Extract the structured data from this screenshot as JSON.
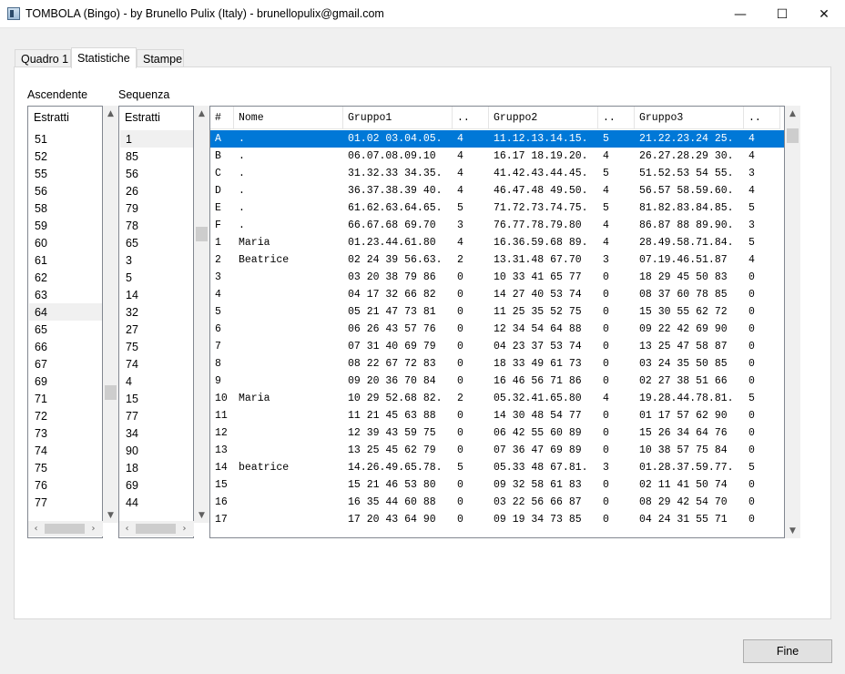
{
  "window": {
    "title": "TOMBOLA (Bingo) - by Brunello Pulix (Italy) - brunellopulix@gmail.com",
    "minimize_glyph": "—",
    "maximize_glyph": "☐",
    "close_glyph": "✕"
  },
  "tabs": [
    "Quadro 1",
    "Statistiche",
    "Stampe"
  ],
  "ascendente": {
    "label": "Ascendente",
    "header": "Estratti",
    "items": [
      "51",
      "52",
      "55",
      "56",
      "58",
      "59",
      "60",
      "61",
      "62",
      "63",
      "64",
      "65",
      "66",
      "67",
      "69",
      "71",
      "72",
      "73",
      "74",
      "75",
      "76",
      "77"
    ],
    "selected": "64"
  },
  "sequenza": {
    "label": "Sequenza",
    "header": "Estratti",
    "items": [
      "1",
      "85",
      "56",
      "26",
      "79",
      "78",
      "65",
      "3",
      "5",
      "14",
      "32",
      "27",
      "75",
      "74",
      "4",
      "15",
      "77",
      "34",
      "90",
      "18",
      "69",
      "44"
    ],
    "selected": "1"
  },
  "grid": {
    "columns": [
      "#",
      "Nome",
      "Gruppo1",
      "..",
      "Gruppo2",
      "..",
      "Gruppo3",
      ".."
    ],
    "rows": [
      [
        "A",
        ".",
        "01.02 03.04.05.",
        "4",
        "11.12.13.14.15.",
        "5",
        "21.22.23.24 25.",
        "4"
      ],
      [
        "B",
        ".",
        "06.07.08.09.10",
        "4",
        "16.17 18.19.20.",
        "4",
        "26.27.28.29 30.",
        "4"
      ],
      [
        "C",
        ".",
        "31.32.33 34.35.",
        "4",
        "41.42.43.44.45.",
        "5",
        "51.52.53 54 55.",
        "3"
      ],
      [
        "D",
        ".",
        "36.37.38.39 40.",
        "4",
        "46.47.48 49.50.",
        "4",
        "56.57 58.59.60.",
        "4"
      ],
      [
        "E",
        ".",
        "61.62.63.64.65.",
        "5",
        "71.72.73.74.75.",
        "5",
        "81.82.83.84.85.",
        "5"
      ],
      [
        "F",
        ".",
        "66.67.68 69.70",
        "3",
        "76.77.78.79.80",
        "4",
        "86.87 88 89.90.",
        "3"
      ],
      [
        "1",
        "Maria",
        "01.23.44.61.80",
        "4",
        "16.36.59.68 89.",
        "4",
        "28.49.58.71.84.",
        "5"
      ],
      [
        "2",
        "Beatrice",
        "02 24 39 56.63.",
        "2",
        "13.31.48 67.70",
        "3",
        "07.19.46.51.87",
        "4"
      ],
      [
        "3",
        "",
        "03 20 38 79 86",
        "0",
        "10 33 41 65 77",
        "0",
        "18 29 45 50 83",
        "0"
      ],
      [
        "4",
        "",
        "04 17 32 66 82",
        "0",
        "14 27 40 53 74",
        "0",
        "08 37 60 78 85",
        "0"
      ],
      [
        "5",
        "",
        "05 21 47 73 81",
        "0",
        "11 25 35 52 75",
        "0",
        "15 30 55 62 72",
        "0"
      ],
      [
        "6",
        "",
        "06 26 43 57 76",
        "0",
        "12 34 54 64 88",
        "0",
        "09 22 42 69 90",
        "0"
      ],
      [
        "7",
        "",
        "07 31 40 69 79",
        "0",
        "04 23 37 53 74",
        "0",
        "13 25 47 58 87",
        "0"
      ],
      [
        "8",
        "",
        "08 22 67 72 83",
        "0",
        "18 33 49 61 73",
        "0",
        "03 24 35 50 85",
        "0"
      ],
      [
        "9",
        "",
        "09 20 36 70 84",
        "0",
        "16 46 56 71 86",
        "0",
        "02 27 38 51 66",
        "0"
      ],
      [
        "10",
        "Maria",
        "10 29 52.68 82.",
        "2",
        "05.32.41.65.80",
        "4",
        "19.28.44.78.81.",
        "5"
      ],
      [
        "11",
        "",
        "11 21 45 63 88",
        "0",
        "14 30 48 54 77",
        "0",
        "01 17 57 62 90",
        "0"
      ],
      [
        "12",
        "",
        "12 39 43 59 75",
        "0",
        "06 42 55 60 89",
        "0",
        "15 26 34 64 76",
        "0"
      ],
      [
        "13",
        "",
        "13 25 45 62 79",
        "0",
        "07 36 47 69 89",
        "0",
        "10 38 57 75 84",
        "0"
      ],
      [
        "14",
        "beatrice",
        "14.26.49.65.78.",
        "5",
        "05.33 48 67.81.",
        "3",
        "01.28.37.59.77.",
        "5"
      ],
      [
        "15",
        "",
        "15 21 46 53 80",
        "0",
        "09 32 58 61 83",
        "0",
        "02 11 41 50 74",
        "0"
      ],
      [
        "16",
        "",
        "16 35 44 60 88",
        "0",
        "03 22 56 66 87",
        "0",
        "08 29 42 54 70",
        "0"
      ],
      [
        "17",
        "",
        "17 20 43 64 90",
        "0",
        "09 19 34 73 85",
        "0",
        "04 24 31 55 71",
        "0"
      ]
    ],
    "selected_row": 0
  },
  "fine_button": "Fine"
}
